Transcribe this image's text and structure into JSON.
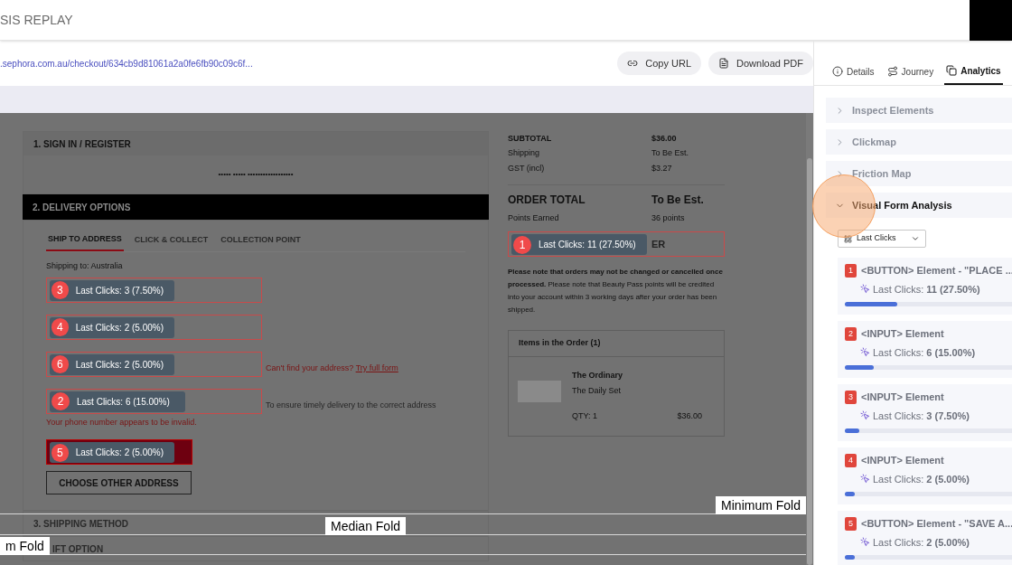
{
  "header": {
    "title": "SIS REPLAY"
  },
  "url_bar": {
    "url": ".sephora.com.au/checkout/634cb9d81061a2a0fe6fb90c09c6f...",
    "buttons": [
      {
        "label": "Copy URL",
        "kind": "link"
      },
      {
        "label": "Download PDF",
        "kind": "pdf"
      }
    ]
  },
  "replay": {
    "sign_in": {
      "title": "1. SIGN IN / REGISTER",
      "masked": "••••• ••••• ••••••••••••••••••"
    },
    "delivery": {
      "title": "2. DELIVERY OPTIONS",
      "tabs": [
        {
          "label": "SHIP TO ADDRESS",
          "selected": true
        },
        {
          "label": "CLICK & COLLECT",
          "selected": false
        },
        {
          "label": "COLLECTION POINT",
          "selected": false
        }
      ],
      "shipping_to": "Shipping to: Australia",
      "fields": [
        {
          "badge": "3",
          "clicks": "Last Clicks: 3 (7.50%)"
        },
        {
          "badge": "4",
          "clicks": "Last Clicks: 2 (5.00%)"
        },
        {
          "badge": "6",
          "clicks": "Last Clicks: 2 (5.00%)",
          "note": {
            "kind": "error",
            "text": "Can't find your address?",
            "link": "Try full form"
          }
        },
        {
          "badge": "2",
          "clicks": "Last Clicks: 6 (15.00%)",
          "note": {
            "kind": "hint",
            "text": "To ensure timely delivery to the correct address"
          },
          "error": "Your phone number appears to be invalid."
        }
      ],
      "save_button": {
        "badge": "5",
        "clicks": "Last Clicks: 2 (5.00%)"
      },
      "choose_button": "CHOOSE OTHER ADDRESS"
    },
    "later_sections": [
      "3. SHIPPING METHOD",
      "IFT OPTION"
    ],
    "summary": {
      "rows": [
        {
          "label": "SUBTOTAL",
          "value": "$36.00",
          "kind": "bold"
        },
        {
          "label": "Shipping",
          "value": "To Be Est.",
          "kind": "plain"
        },
        {
          "label": "GST (incl)",
          "value": "$3.27",
          "kind": "plain"
        }
      ],
      "total_label": "ORDER TOTAL",
      "total_value": "To Be Est.",
      "points_label": "Points Earned",
      "points_value": "36 points",
      "place_button": {
        "badge": "1",
        "clicks": "Last Clicks: 11 (27.50%)",
        "label": "ER"
      },
      "notice": "**Please note that orders may not be changed or cancelled once processed.** Please note that Beauty Pass points will be credited into your account within 3 working days after your order has been shipped.",
      "items": {
        "title": "Items in the Order (1)",
        "brand": "The Ordinary",
        "product": "The Daily Set",
        "qty": "QTY: 1",
        "price": "$36.00"
      }
    },
    "folds": [
      {
        "label": "Minimum Fold"
      },
      {
        "label": "Median Fold"
      },
      {
        "label": "m Fold"
      }
    ]
  },
  "sidebar": {
    "tabs": [
      {
        "label": "Details",
        "kind": "info",
        "selected": false
      },
      {
        "label": "Journey",
        "kind": "journey",
        "selected": false
      },
      {
        "label": "Analytics",
        "kind": "analytics",
        "selected": true
      }
    ],
    "sections": [
      {
        "title": "Inspect Elements",
        "expanded": false
      },
      {
        "title": "Clickmap",
        "expanded": false
      },
      {
        "title": "Friction Map",
        "expanded": false
      },
      {
        "title": "Visual Form Analysis",
        "expanded": true
      }
    ],
    "filter": "Last Clicks",
    "elements": [
      {
        "badge": "1",
        "title": "<BUTTON> Element - \"PLACE ...",
        "clicks": "Last Clicks: **11 (27.50%)**",
        "level": 0.275
      },
      {
        "badge": "2",
        "title": "<INPUT> Element",
        "clicks": "Last Clicks: **6 (15.00%)**",
        "level": 0.15
      },
      {
        "badge": "3",
        "title": "<INPUT> Element",
        "clicks": "Last Clicks: **3 (7.50%)**",
        "level": 0.075
      },
      {
        "badge": "4",
        "title": "<INPUT> Element",
        "clicks": "Last Clicks: **2 (5.00%)**",
        "level": 0.05
      },
      {
        "badge": "5",
        "title": "<BUTTON> Element - \"SAVE A...",
        "clicks": "Last Clicks: **2 (5.00%)**",
        "level": 0.05
      }
    ]
  }
}
